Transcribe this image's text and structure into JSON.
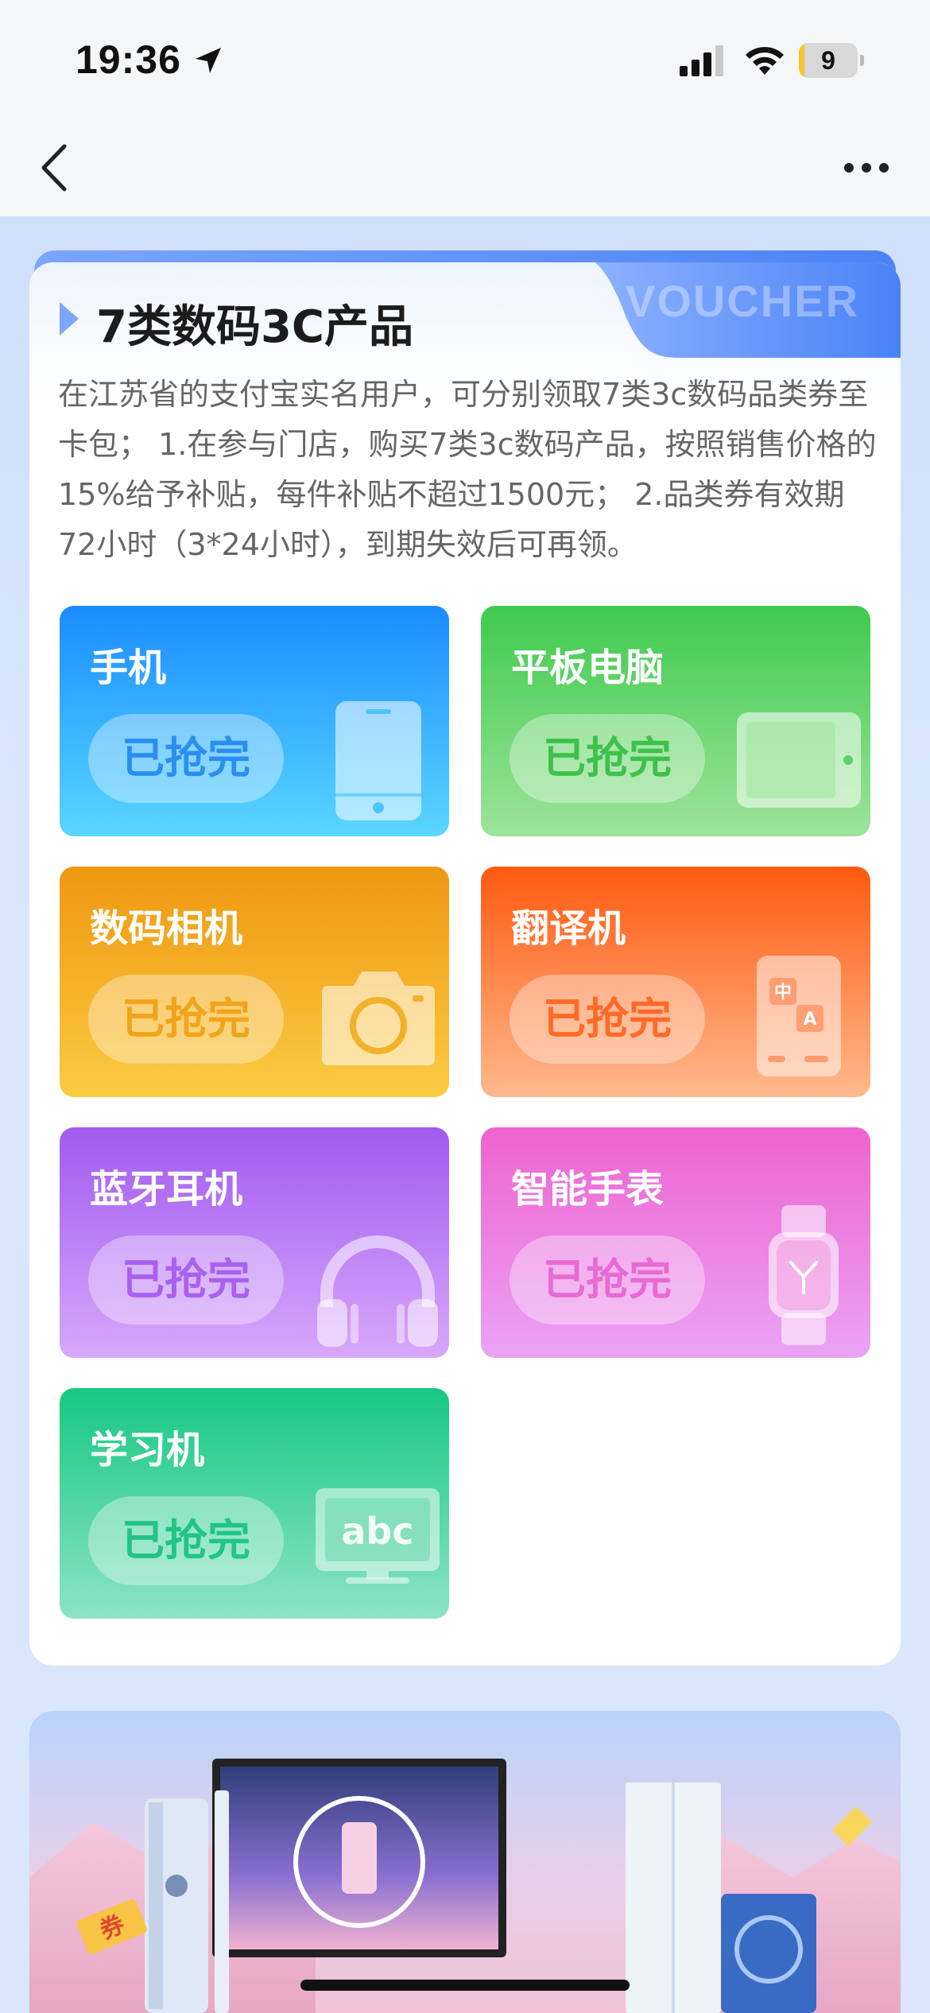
{
  "status_bar": {
    "time": "19:36",
    "battery_level": "9",
    "battery_fraction": 0.09,
    "icons": [
      "location-arrow-icon",
      "signal-icon",
      "wifi-icon",
      "battery-icon"
    ]
  },
  "nav": {
    "back_icon": "chevron-left-icon",
    "more_icon": "more-dots-icon"
  },
  "card": {
    "tab_text": "VOUCHER",
    "title": "7类数码3C产品",
    "description": "在江苏省的支付宝实名用户，可分别领取7类3c数码品类券至卡包； 1.在参与门店，购买7类3c数码产品，按照销售价格的15%给予补贴，每件补贴不超过1500元； 2.品类券有效期72小时（3*24小时），到期失效后可再领。"
  },
  "categories": [
    {
      "name": "手机",
      "button": "已抢完",
      "icon": "phone-icon",
      "colors": [
        "#1a8cff",
        "#5ad6ff"
      ]
    },
    {
      "name": "平板电脑",
      "button": "已抢完",
      "icon": "tablet-icon",
      "colors": [
        "#3fca4e",
        "#9de49a"
      ]
    },
    {
      "name": "数码相机",
      "button": "已抢完",
      "icon": "camera-icon",
      "colors": [
        "#ef9711",
        "#fbcb42"
      ]
    },
    {
      "name": "翻译机",
      "button": "已抢完",
      "icon": "translator-icon",
      "icon_text": [
        "中",
        "A"
      ],
      "colors": [
        "#ff5a10",
        "#ffb98d"
      ]
    },
    {
      "name": "蓝牙耳机",
      "button": "已抢完",
      "icon": "headphones-icon",
      "colors": [
        "#a15af0",
        "#d8a8fb"
      ]
    },
    {
      "name": "智能手表",
      "button": "已抢完",
      "icon": "smartwatch-icon",
      "colors": [
        "#ee63cf",
        "#eaa3f5"
      ]
    },
    {
      "name": "学习机",
      "button": "已抢完",
      "icon": "learning-machine-icon",
      "icon_text": "abc",
      "colors": [
        "#16c882",
        "#8de3c7"
      ]
    }
  ],
  "banner": {
    "ticket_text": "券"
  }
}
